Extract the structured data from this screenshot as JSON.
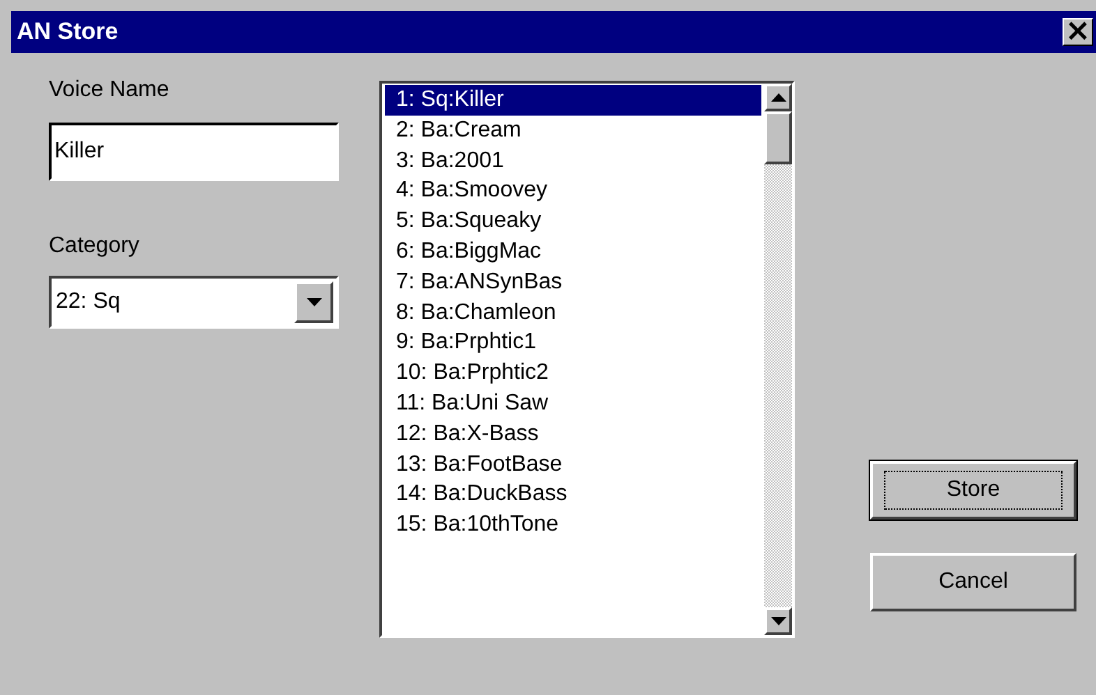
{
  "window": {
    "title": "AN Store",
    "close": "×"
  },
  "voice_name": {
    "label": "Voice Name",
    "value": "Killer"
  },
  "category": {
    "label": "Category",
    "value": "22: Sq"
  },
  "voices": [
    {
      "label": "1: Sq:Killer",
      "selected": true
    },
    {
      "label": "2: Ba:Cream",
      "selected": false
    },
    {
      "label": "3: Ba:2001",
      "selected": false
    },
    {
      "label": "4: Ba:Smoovey",
      "selected": false
    },
    {
      "label": "5: Ba:Squeaky",
      "selected": false
    },
    {
      "label": "6: Ba:BiggMac",
      "selected": false
    },
    {
      "label": "7: Ba:ANSynBas",
      "selected": false
    },
    {
      "label": "8: Ba:Chamleon",
      "selected": false
    },
    {
      "label": "9: Ba:Prphtic1",
      "selected": false
    },
    {
      "label": "10: Ba:Prphtic2",
      "selected": false
    },
    {
      "label": "11: Ba:Uni Saw",
      "selected": false
    },
    {
      "label": "12: Ba:X-Bass",
      "selected": false
    },
    {
      "label": "13: Ba:FootBase",
      "selected": false
    },
    {
      "label": "14: Ba:DuckBass",
      "selected": false
    },
    {
      "label": "15: Ba:10thTone",
      "selected": false
    }
  ],
  "buttons": [
    {
      "label": "Store",
      "kind": "default"
    },
    {
      "label": "Cancel",
      "kind": "normal"
    }
  ]
}
